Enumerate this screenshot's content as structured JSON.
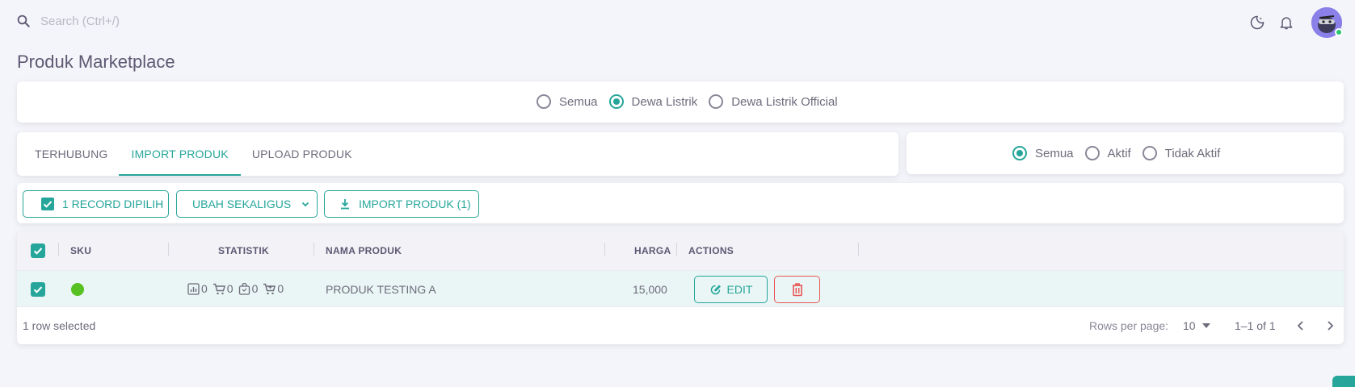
{
  "search": {
    "placeholder": "Search (Ctrl+/)"
  },
  "page": {
    "title": "Produk Marketplace"
  },
  "store_filter": {
    "options": [
      "Semua",
      "Dewa Listrik",
      "Dewa Listrik Official"
    ],
    "selected": "Dewa Listrik"
  },
  "tabs": [
    "TERHUBUNG",
    "IMPORT PRODUK",
    "UPLOAD PRODUK"
  ],
  "active_tab": "IMPORT PRODUK",
  "status_filter": {
    "options": [
      "Semua",
      "Aktif",
      "Tidak Aktif"
    ],
    "selected": "Semua"
  },
  "toolbar": {
    "selected_label": "1 RECORD DIPILIH",
    "bulk_edit_label": "UBAH SEKALIGUS",
    "import_label": "IMPORT PRODUK (1)"
  },
  "table": {
    "headers": {
      "sku": "SKU",
      "statistik": "STATISTIK",
      "nama": "NAMA PRODUK",
      "harga": "HARGA",
      "actions": "ACTIONS"
    },
    "rows": [
      {
        "status_color": "#57c022",
        "stats": [
          "0",
          "0",
          "0",
          "0"
        ],
        "nama": "PRODUK TESTING A",
        "harga": "15,000",
        "edit_label": "EDIT"
      }
    ],
    "footer": {
      "selected_text": "1 row selected",
      "rows_per_page_label": "Rows per page:",
      "rows_per_page_value": "10",
      "range_text": "1–1 of 1"
    }
  },
  "colors": {
    "accent": "#26a69a",
    "danger": "#ea5455",
    "avatar": "#7367f0"
  }
}
